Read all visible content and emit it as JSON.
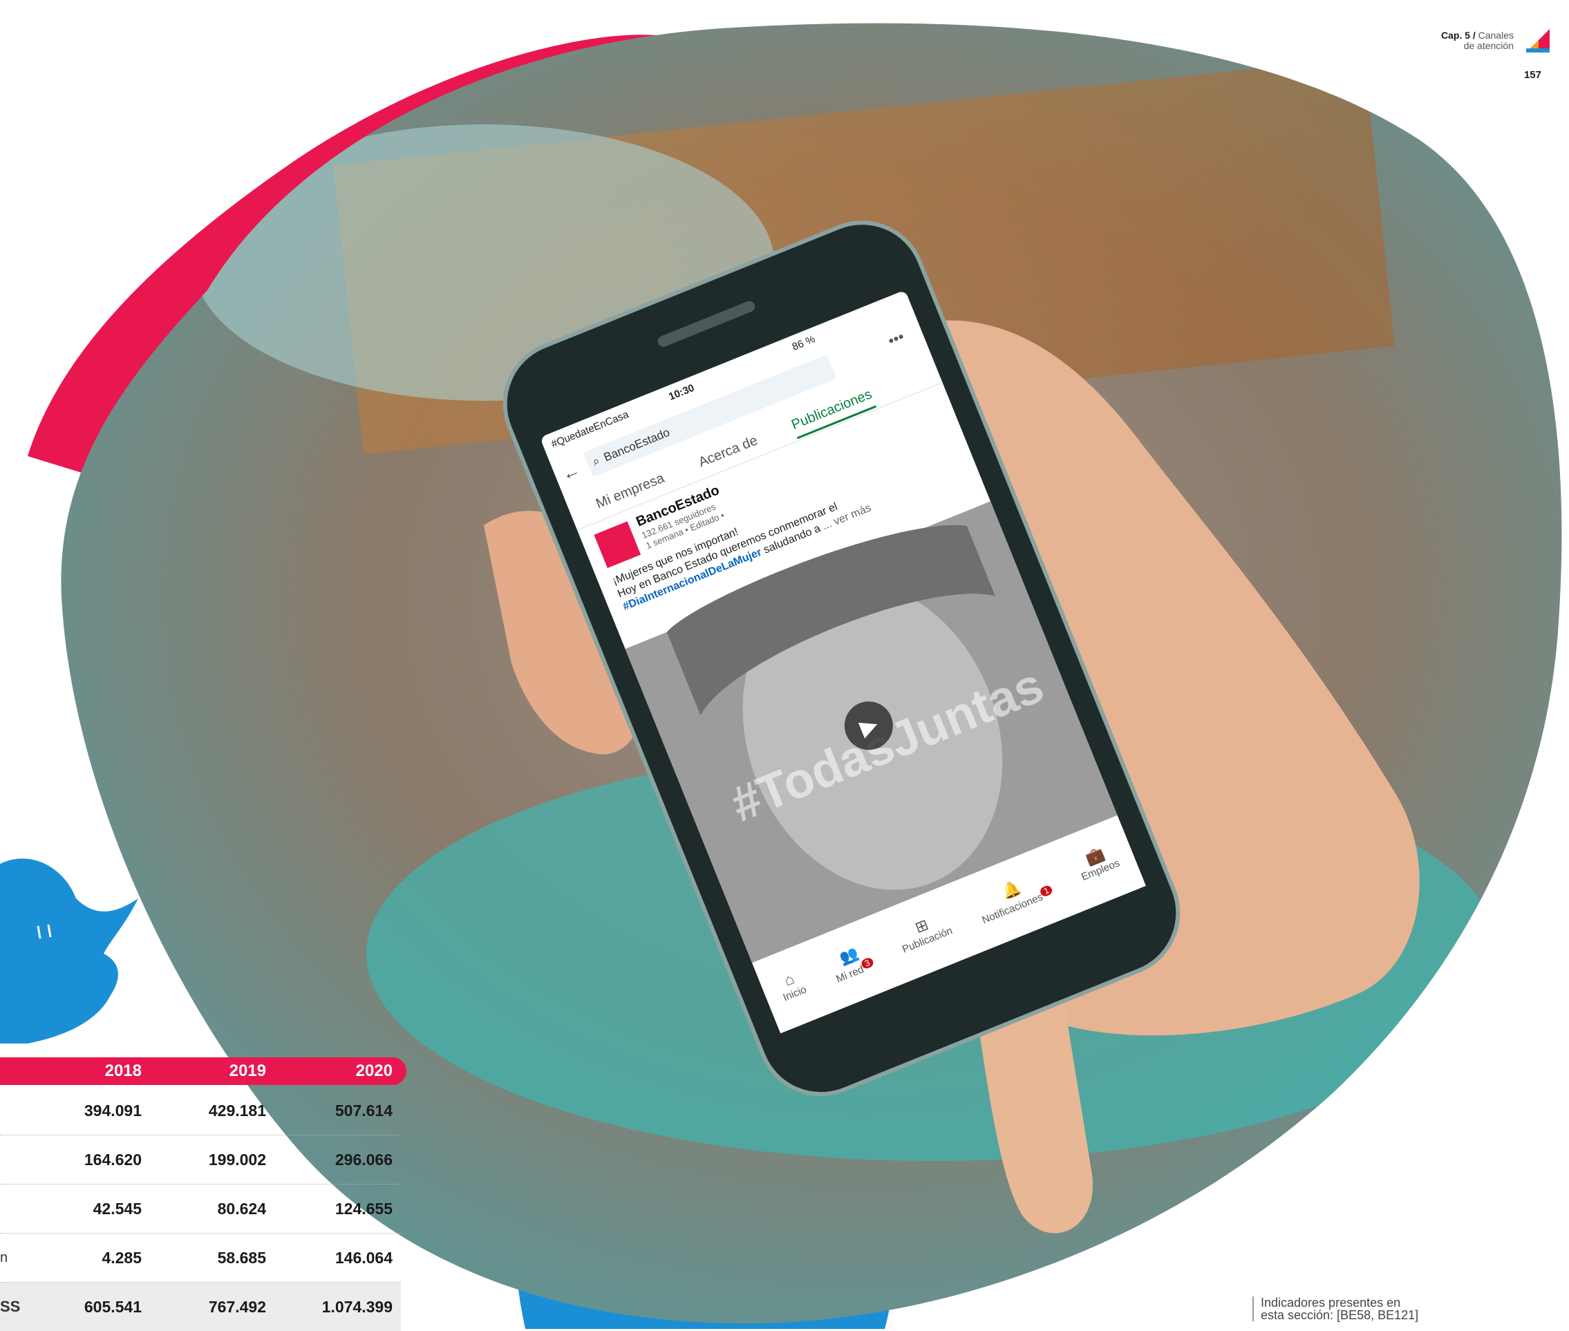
{
  "header": {
    "chapter_bold": "Cap. 5 /",
    "chapter_line1": "Canales",
    "chapter_line2": "de atención",
    "page_number": "157"
  },
  "phone": {
    "status": {
      "carrier": "#QuedateEnCasa",
      "time": "10:30",
      "battery": "86 %"
    },
    "search_text": "BancoEstado",
    "tabs": [
      "Mi empresa",
      "Acerca de",
      "Publicaciones"
    ],
    "post": {
      "company": "BancoEstado",
      "followers": "132.661 seguidores",
      "meta": "1 semana • Editado •",
      "line1": "¡Mujeres que nos importan!",
      "line2": "Hoy en Banco Estado queremos conmemorar el",
      "hashtag": "#DiaInternacionalDeLaMujer",
      "line3_rest": "saludando a",
      "see_more": "... ver más",
      "image_text": "#TodasJuntas"
    },
    "nav": [
      {
        "label": "Inicio",
        "badge": ""
      },
      {
        "label": "Mi red",
        "badge": "3"
      },
      {
        "label": "Publicación",
        "badge": ""
      },
      {
        "label": "Notificaciones",
        "badge": "1"
      },
      {
        "label": "Empleos",
        "badge": ""
      }
    ]
  },
  "table": {
    "years": [
      "2018",
      "2019",
      "2020"
    ],
    "rows": [
      {
        "label": "",
        "values": [
          "394.091",
          "429.181",
          "507.614"
        ]
      },
      {
        "label": "",
        "values": [
          "164.620",
          "199.002",
          "296.066"
        ]
      },
      {
        "label": "",
        "values": [
          "42.545",
          "80.624",
          "124.655"
        ]
      },
      {
        "label": "n",
        "values": [
          "4.285",
          "58.685",
          "146.064"
        ]
      },
      {
        "label": "SS",
        "values": [
          "605.541",
          "767.492",
          "1.074.399"
        ]
      }
    ]
  },
  "indicators": {
    "line1": "Indicadores presentes en",
    "line2": "esta sección: [BE58, BE121]"
  },
  "colors": {
    "brand_red": "#e8174f",
    "brand_blue": "#1b8fd6"
  }
}
